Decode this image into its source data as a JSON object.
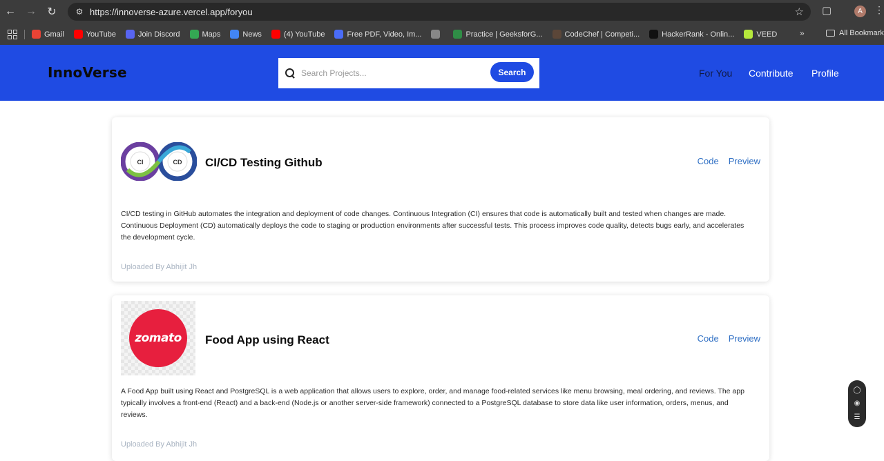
{
  "browser": {
    "url": "https://innoverse-azure.vercel.app/foryou",
    "profile_initial": "A",
    "bookmarks": [
      {
        "label": "Gmail",
        "icon": "gmail-icon",
        "color": "#ea4335"
      },
      {
        "label": "YouTube",
        "icon": "youtube-icon",
        "color": "#ff0000"
      },
      {
        "label": "Join Discord",
        "icon": "discord-icon",
        "color": "#5865f2"
      },
      {
        "label": "Maps",
        "icon": "maps-icon",
        "color": "#34a853"
      },
      {
        "label": "News",
        "icon": "news-icon",
        "color": "#4285f4"
      },
      {
        "label": "(4) YouTube",
        "icon": "youtube-icon",
        "color": "#ff0000"
      },
      {
        "label": "Free PDF, Video, Im...",
        "icon": "pdf-tool-icon",
        "color": "#4a6cf7"
      },
      {
        "label": "",
        "icon": "dots-icon",
        "color": "#888888"
      },
      {
        "label": "Practice | GeeksforG...",
        "icon": "geeksforgeeks-icon",
        "color": "#2f8d46"
      },
      {
        "label": "CodeChef | Competi...",
        "icon": "codechef-icon",
        "color": "#5b4638"
      },
      {
        "label": "HackerRank - Onlin...",
        "icon": "hackerrank-icon",
        "color": "#111111"
      },
      {
        "label": "VEED",
        "icon": "veed-icon",
        "color": "#b6e83c"
      }
    ],
    "more": "»",
    "all_bookmarks": "All Bookmarks"
  },
  "header": {
    "logo": "InnoVerse",
    "search_placeholder": "Search Projects...",
    "search_button": "Search",
    "nav": [
      "For You",
      "Contribute",
      "Profile"
    ],
    "active_nav": "For You",
    "accent_color": "#1f4be3"
  },
  "projects": [
    {
      "title": "CI/CD Testing Github",
      "image": "cicd-infinity-logo",
      "code_label": "Code",
      "preview_label": "Preview",
      "description": "CI/CD testing in GitHub automates the integration and deployment of code changes. Continuous Integration (CI) ensures that code is automatically built and tested when changes are made. Continuous Deployment (CD) automatically deploys the code to staging or production environments after successful tests. This process improves code quality, detects bugs early, and accelerates the development cycle.",
      "uploaded_by": "Uploaded By Abhijit Jh",
      "logo_ci": "CI",
      "logo_cd": "CD"
    },
    {
      "title": "Food App using React",
      "image": "zomato-logo",
      "logo_text": "zomato",
      "code_label": "Code",
      "preview_label": "Preview",
      "description": "A Food App built using React and PostgreSQL is a web application that allows users to explore, order, and manage food-related services like menu browsing, meal ordering, and reviews. The app typically involves a front-end (React) and a back-end (Node.js or another server-side framework) connected to a PostgreSQL database to store data like user information, orders, menus, and reviews.",
      "uploaded_by": "Uploaded By Abhijit Jh"
    }
  ]
}
